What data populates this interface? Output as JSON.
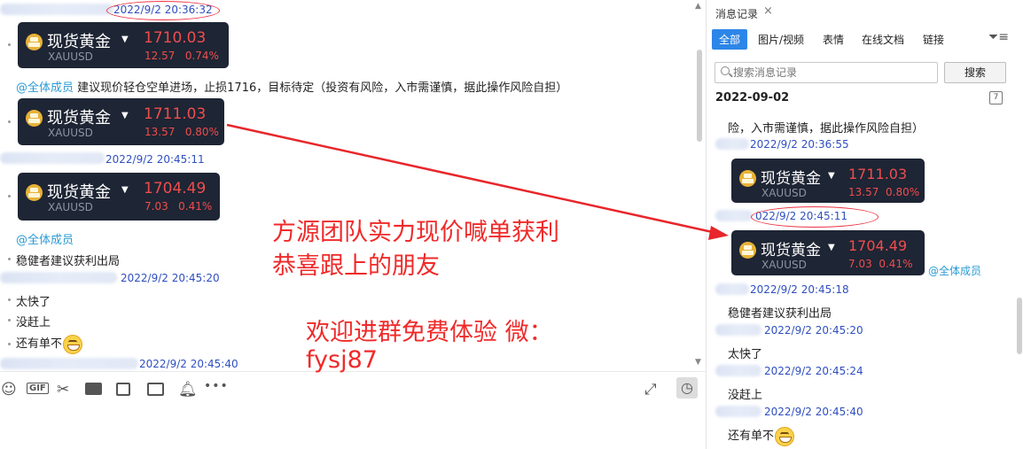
{
  "chat": {
    "top_timestamp": "2022/9/2 20:36:32",
    "card1": {
      "name": "现货黄金",
      "code": "XAUUSD",
      "price": "1710.03",
      "change": "12.57",
      "pct": "0.74%"
    },
    "msg1_mention": "@全体成员",
    "msg1_text": " 建议现价轻仓空单进场，止损1716，目标待定（投资有风险，入市需谨慎，据此操作风险自担）",
    "card2": {
      "name": "现货黄金",
      "code": "XAUUSD",
      "price": "1711.03",
      "change": "13.57",
      "pct": "0.80%"
    },
    "ts2": "2022/9/2 20:45:11",
    "card3": {
      "name": "现货黄金",
      "code": "XAUUSD",
      "price": "1704.49",
      "change": "7.03",
      "pct": "0.41%"
    },
    "msg2_mention": "@全体成员",
    "msg2_text": "稳健者建议获利出局",
    "ts3": "2022/9/2 20:45:20",
    "msg3": "太快了",
    "msg4": "没赶上",
    "msg5": "还有单不",
    "ts4": "2022/9/2 20:45:40"
  },
  "overlay": {
    "line1": "方源团队实力现价喊单获利",
    "line2": "恭喜跟上的朋友",
    "line3": "欢迎进群免费体验 微：",
    "line4": "fysj87"
  },
  "toolbar": {
    "gif_label": "GIF",
    "more_label": "•••"
  },
  "panel": {
    "title": "消息记录",
    "close": "×",
    "tabs": [
      "全部",
      "图片/视频",
      "表情",
      "在线文档",
      "链接"
    ],
    "search_placeholder": "搜索消息记录",
    "search_button": "搜索",
    "date": "2022-09-02",
    "calendar_day": "7",
    "partial_text": "险，入市需谨慎，据此操作风险自担）",
    "ts1": "2022/9/2 20:36:55",
    "card1": {
      "name": "现货黄金",
      "code": "XAUUSD",
      "price": "1711.03",
      "change": "13.57",
      "pct": "0.80%"
    },
    "ts2": "022/9/2 20:45:11",
    "card2": {
      "name": "现货黄金",
      "code": "XAUUSD",
      "price": "1704.49",
      "change": "7.03",
      "pct": "0.41%"
    },
    "mention": "@全体成员",
    "ts3": "2022/9/2 20:45:18",
    "msg1": "稳健者建议获利出局",
    "ts4": "2022/9/2 20:45:20",
    "msg2": "太快了",
    "ts5": "2022/9/2 20:45:24",
    "msg3": "没赶上",
    "ts6": "2022/9/2 20:45:40",
    "msg4": "还有单不"
  },
  "colors": {
    "accent": "#2c86e8",
    "card_bg": "#1e2534",
    "price_red": "#ee4d4d",
    "overlay_red": "#f02a2a",
    "mention": "#2b9bd4"
  }
}
